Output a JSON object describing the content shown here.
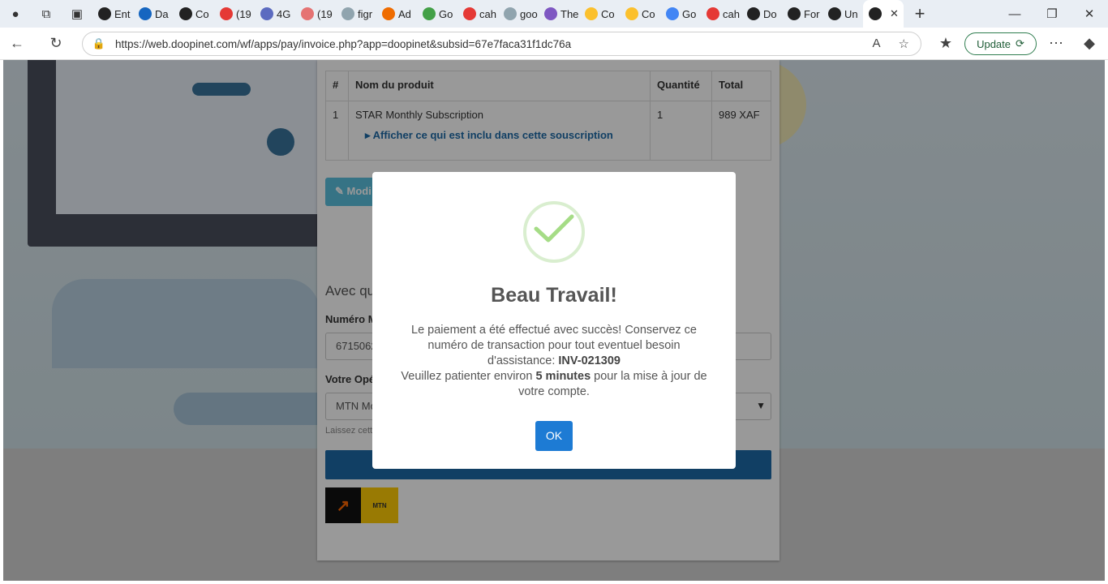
{
  "browser": {
    "tabs": [
      {
        "label": "Ent",
        "color": "#222"
      },
      {
        "label": "Da",
        "color": "#1565c0"
      },
      {
        "label": "Co",
        "color": "#222"
      },
      {
        "label": "(19",
        "color": "#e53935"
      },
      {
        "label": "4G",
        "color": "#5c6bc0"
      },
      {
        "label": "(19",
        "color": "#e57373"
      },
      {
        "label": "figr",
        "color": "#90a4ae"
      },
      {
        "label": "Ad",
        "color": "#ef6c00"
      },
      {
        "label": "Go",
        "color": "#43a047"
      },
      {
        "label": "cah",
        "color": "#e53935"
      },
      {
        "label": "goo",
        "color": "#90a4ae"
      },
      {
        "label": "The",
        "color": "#7e57c2"
      },
      {
        "label": "Co",
        "color": "#fbc02d"
      },
      {
        "label": "Co",
        "color": "#fbc02d"
      },
      {
        "label": "Go",
        "color": "#4285f4"
      },
      {
        "label": "cah",
        "color": "#e53935"
      },
      {
        "label": "Do",
        "color": "#222"
      },
      {
        "label": "For",
        "color": "#222"
      },
      {
        "label": "Un",
        "color": "#222"
      },
      {
        "label": "",
        "color": "#222"
      }
    ],
    "url": "https://web.doopinet.com/wf/apps/pay/invoice.php?app=doopinet&subsid=67e7faca31f1dc76a",
    "update_label": "Update"
  },
  "invoice": {
    "headers": [
      "#",
      "Nom du produit",
      "Quantité",
      "Total"
    ],
    "row": {
      "num": "1",
      "product": "STAR Monthly Subscription",
      "qty": "1",
      "total": "989 XAF"
    },
    "include_link": "Afficher ce qui est inclu dans cette souscription",
    "modify_label": "Modi",
    "method_heading": "Avec que",
    "number_label": "Numéro M",
    "number_value": "6715062",
    "operator_label": "Votre Opé",
    "operator_value": "MTN Mo",
    "hint": "Laissez cette",
    "logos": {
      "om": "Orange Money",
      "mtn": "MTN Mobile Money"
    }
  },
  "modal": {
    "title": "Beau Travail!",
    "line1": "Le paiement a été effectué avec succès! Conservez ce numéro de transaction pour tout eventuel besoin d'assistance: ",
    "ref": "INV-021309",
    "line2a": "Veuillez patienter environ ",
    "line2b": "5 minutes",
    "line2c": " pour la mise à jour de votre compte.",
    "ok_label": "OK"
  }
}
